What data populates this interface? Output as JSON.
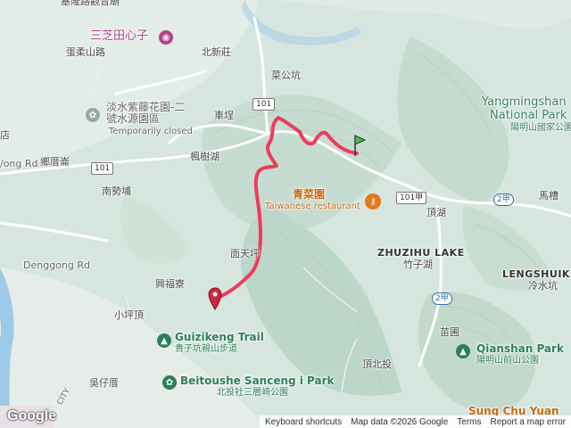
{
  "map": {
    "colors": {
      "terrain": "#d6e6df",
      "route": "#ee3b5b",
      "water": "#9ec9e8",
      "road": "#ffffff"
    },
    "labels": {
      "top_left": "基隆路觀音廟",
      "road_zh": "蛋柔山路",
      "beixinzhuang": "北新莊",
      "caigongkeng": "菜公坑",
      "chepu": "車埕",
      "fengshuhu": "楓樹湖",
      "nanshipu": "南勢埔",
      "jun_ma": "鄉厝崙",
      "denggong_rd": "Denggong Rd",
      "xingfuliao": "興福寮",
      "xiaopingding": "小坪頂",
      "mianyinping": "面天坪",
      "wuzicuo": "吳仔厝",
      "dinghu": "頂湖",
      "mabu": "馬槽",
      "zhuzihu_lake": "ZHUZIHU LAKE",
      "zhuzihu_zh": "竹子湖",
      "lengshuikeng": "LENGSHUIKENG",
      "lengshuikeng_zh": "冷水坑",
      "miaopu": "苗圃",
      "dingbeitou": "頂北投",
      "left_dian": "店",
      "left_ong_rd": "/ong Rd",
      "city": "CITY"
    },
    "shields": {
      "r101_a": "101",
      "r101_b": "101",
      "r101_c": "101甲",
      "r2_a": "2甲",
      "r2_b": "2甲"
    },
    "pois": {
      "sanzhitian_name": "三芝田心子",
      "wisteria_name_1": "淡水紫藤花園-二",
      "wisteria_name_2": "號水源園區",
      "wisteria_status": "Temporarily closed",
      "qingcaiyuan_name": "青菜園",
      "qingcaiyuan_sub": "Taiwanese restaurant",
      "guizikeng_name": "Guizikeng Trail",
      "guizikeng_sub": "貴子坑親山步道",
      "beitoushe_name": "Beitoushe Sanceng   i Park",
      "beitoushe_sub": "北投社三層崎公園",
      "yangmingshan_name_1": "Yangmingshan",
      "yangmingshan_name_2": "National Park",
      "yangmingshan_sub": "陽明山國家公園",
      "qianshan_name": "Qianshan Park",
      "qianshan_sub": "陽明山前山公園",
      "sungchuyuan_name": "Sung Chu Yuan"
    },
    "icons": [
      "camera-icon",
      "flower-icon",
      "restaurant-icon",
      "trail-icon",
      "park-icon",
      "tree-icon",
      "start-flag-icon",
      "end-pin-icon"
    ],
    "google_logo": "Google",
    "attribution": {
      "keyboard": "Keyboard shortcuts",
      "data": "Map data ©2026 Google",
      "terms": "Terms",
      "report": "Report a map error"
    }
  }
}
